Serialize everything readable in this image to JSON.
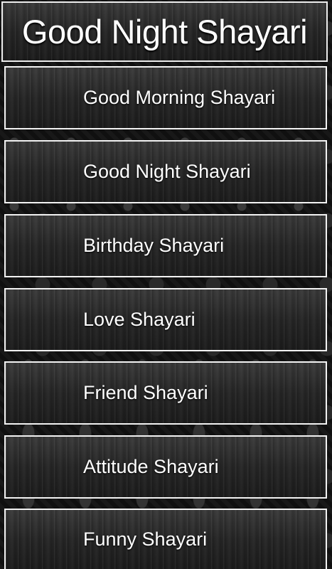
{
  "header": {
    "title": "Good Night Shayari"
  },
  "menu": {
    "items": [
      {
        "label": "Good Morning Shayari"
      },
      {
        "label": "Good Night Shayari"
      },
      {
        "label": "Birthday Shayari"
      },
      {
        "label": "Love Shayari"
      },
      {
        "label": "Friend Shayari"
      },
      {
        "label": "Attitude Shayari"
      },
      {
        "label": "Funny Shayari"
      }
    ]
  }
}
